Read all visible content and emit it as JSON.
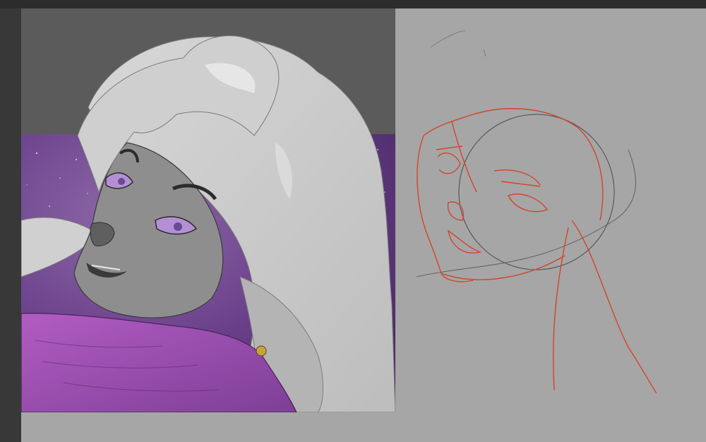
{
  "app": {
    "icons": [
      "illustration",
      "sketch"
    ]
  },
  "colors": {
    "workspace_bg": "#383838",
    "canvas_bg": "#a6a6a6",
    "artwork_sky": "#5b5b5b",
    "nebula_purple": "#7a4f9a",
    "scarf_purple": "#a652b8",
    "hair_gray": "#c9c9c9",
    "skin_gray": "#8e8e8e",
    "eye_violet": "#b48fd6",
    "sketch_red": "#d2452a",
    "sketch_circle": "#5e5e5e"
  }
}
